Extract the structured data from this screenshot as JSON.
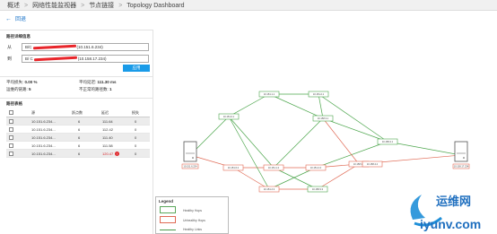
{
  "breadcrumb": {
    "items": [
      "概述",
      "网络性能监视器",
      "节点链接",
      "Topology Dashboard"
    ],
    "separator": ">"
  },
  "back": {
    "label": "回退"
  },
  "path_settings": {
    "title": "路径详细信息",
    "from_label": "从",
    "from_value_prefix": "B/C",
    "from_value_suffix": "(10.151.6.234)",
    "to_label": "到",
    "to_value_prefix": "B/ C",
    "to_value_suffix": "(10.158.17.234)",
    "apply_label": "应用"
  },
  "stats": {
    "avg_loss_label": "平均损失:",
    "avg_loss_value": "0.00 %",
    "avg_latency_label": "平均延迟:",
    "avg_latency_value": "111.30 ms",
    "healthy_label": "运维的链路:",
    "healthy_value": "5",
    "unhealthy_label": "不正常的路径数:",
    "unhealthy_value": "1"
  },
  "paths_table": {
    "title": "路径表格",
    "columns": [
      "源",
      "跃点数",
      "延迟",
      "损失"
    ],
    "rows": [
      {
        "source": "10.151.6.234...",
        "hops": "6",
        "latency": "111.64",
        "loss": "0",
        "warning": false
      },
      {
        "source": "10.151.6.234...",
        "hops": "6",
        "latency": "112.42",
        "loss": "0",
        "warning": false
      },
      {
        "source": "10.151.6.234...",
        "hops": "6",
        "latency": "111.40",
        "loss": "0",
        "warning": false
      },
      {
        "source": "10.151.6.234...",
        "hops": "6",
        "latency": "111.58",
        "loss": "0",
        "warning": false
      },
      {
        "source": "10.151.6.234...",
        "hops": "6",
        "latency": "120.47",
        "loss": "0",
        "warning": true
      }
    ]
  },
  "legend": {
    "title": "Legend",
    "healthy_hops": "Healthy Hops",
    "unhealthy_hops": "Unhealthy Hops",
    "healthy_links": "Healthy Links"
  },
  "topology": {
    "healthy_color": "#4da64d",
    "unhealthy_color": "#e06a55",
    "nodes": [
      {
        "id": "src",
        "kind": "server",
        "label": "10.151.6.234",
        "status": "bad"
      },
      {
        "id": "a1",
        "kind": "hop",
        "label": "10.151.6.1",
        "status": "good"
      },
      {
        "id": "b1",
        "kind": "hop",
        "label": "10.151.1.1",
        "status": "good"
      },
      {
        "id": "c1",
        "kind": "hop",
        "label": "10.151.2.1",
        "status": "good"
      },
      {
        "id": "d1",
        "kind": "hop",
        "label": "10.158.3.1",
        "status": "good"
      },
      {
        "id": "e1",
        "kind": "hop",
        "label": "10.158.4.1",
        "status": "good"
      },
      {
        "id": "a2",
        "kind": "hop",
        "label": "10.151.6.2",
        "status": "bad"
      },
      {
        "id": "b2",
        "kind": "hop",
        "label": "10.151.1.2",
        "status": "bad"
      },
      {
        "id": "c2",
        "kind": "hop",
        "label": "10.151.2.2",
        "status": "bad"
      },
      {
        "id": "d2",
        "kind": "hop",
        "label": "10.158.3.2",
        "status": "bad"
      },
      {
        "id": "e2",
        "kind": "hop",
        "label": "10.158.4.2",
        "status": "bad"
      },
      {
        "id": "c3",
        "kind": "hop",
        "label": "10.151.2.3",
        "status": "bad"
      },
      {
        "id": "d3",
        "kind": "hop",
        "label": "10.158.3.3",
        "status": "good"
      },
      {
        "id": "dst",
        "kind": "server",
        "label": "10.158.17.234",
        "status": "bad"
      }
    ]
  },
  "watermark": {
    "brand": "运维网",
    "url": "iyunv.com"
  }
}
